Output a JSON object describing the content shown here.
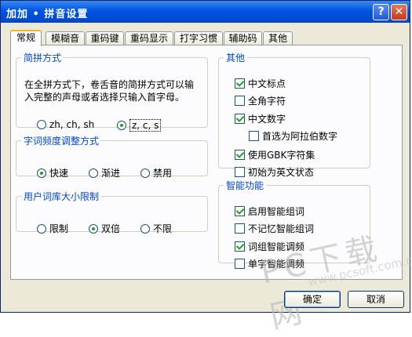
{
  "window": {
    "title": "加加 • 拼音设置",
    "help_label": "?",
    "close_label": "✕"
  },
  "tabs": [
    {
      "label": "常规",
      "active": true
    },
    {
      "label": "模糊音"
    },
    {
      "label": "重码键"
    },
    {
      "label": "重码显示"
    },
    {
      "label": "打字习惯"
    },
    {
      "label": "辅助码"
    },
    {
      "label": "其他"
    }
  ],
  "jianpin": {
    "legend": "简拼方式",
    "description": "在全拼方式下，卷舌音的简拼方式可以输入完整的声母或者选择只输入首字母。",
    "options": [
      {
        "label": "zh, ch, sh",
        "selected": false
      },
      {
        "label": "z, c, s",
        "selected": true
      }
    ]
  },
  "frequency": {
    "legend": "字词频度调整方式",
    "options": [
      {
        "label": "快速",
        "selected": true
      },
      {
        "label": "渐进",
        "selected": false
      },
      {
        "label": "禁用",
        "selected": false
      }
    ]
  },
  "lexicon": {
    "legend": "用户词库大小限制",
    "options": [
      {
        "label": "限制",
        "selected": false
      },
      {
        "label": "双倍",
        "selected": true
      },
      {
        "label": "不限",
        "selected": false
      }
    ]
  },
  "other": {
    "legend": "其他",
    "items": [
      {
        "label": "中文标点",
        "checked": true
      },
      {
        "label": "全角字符",
        "checked": false
      },
      {
        "label": "中文数字",
        "checked": true
      },
      {
        "label": "首选为阿拉伯数字",
        "checked": false
      },
      {
        "label": "使用GBK字符集",
        "checked": true
      },
      {
        "label": "初始为英文状态",
        "checked": false
      }
    ]
  },
  "smart": {
    "legend": "智能功能",
    "items": [
      {
        "label": "启用智能组词",
        "checked": true
      },
      {
        "label": "不记忆智能组词",
        "checked": false
      },
      {
        "label": "词组智能调频",
        "checked": true
      },
      {
        "label": "单字智能调频",
        "checked": false
      }
    ]
  },
  "buttons": {
    "ok": "确定",
    "cancel": "取消"
  },
  "watermark": {
    "main": "PC下载网",
    "sub": "www.pcsoft.com.cn"
  }
}
